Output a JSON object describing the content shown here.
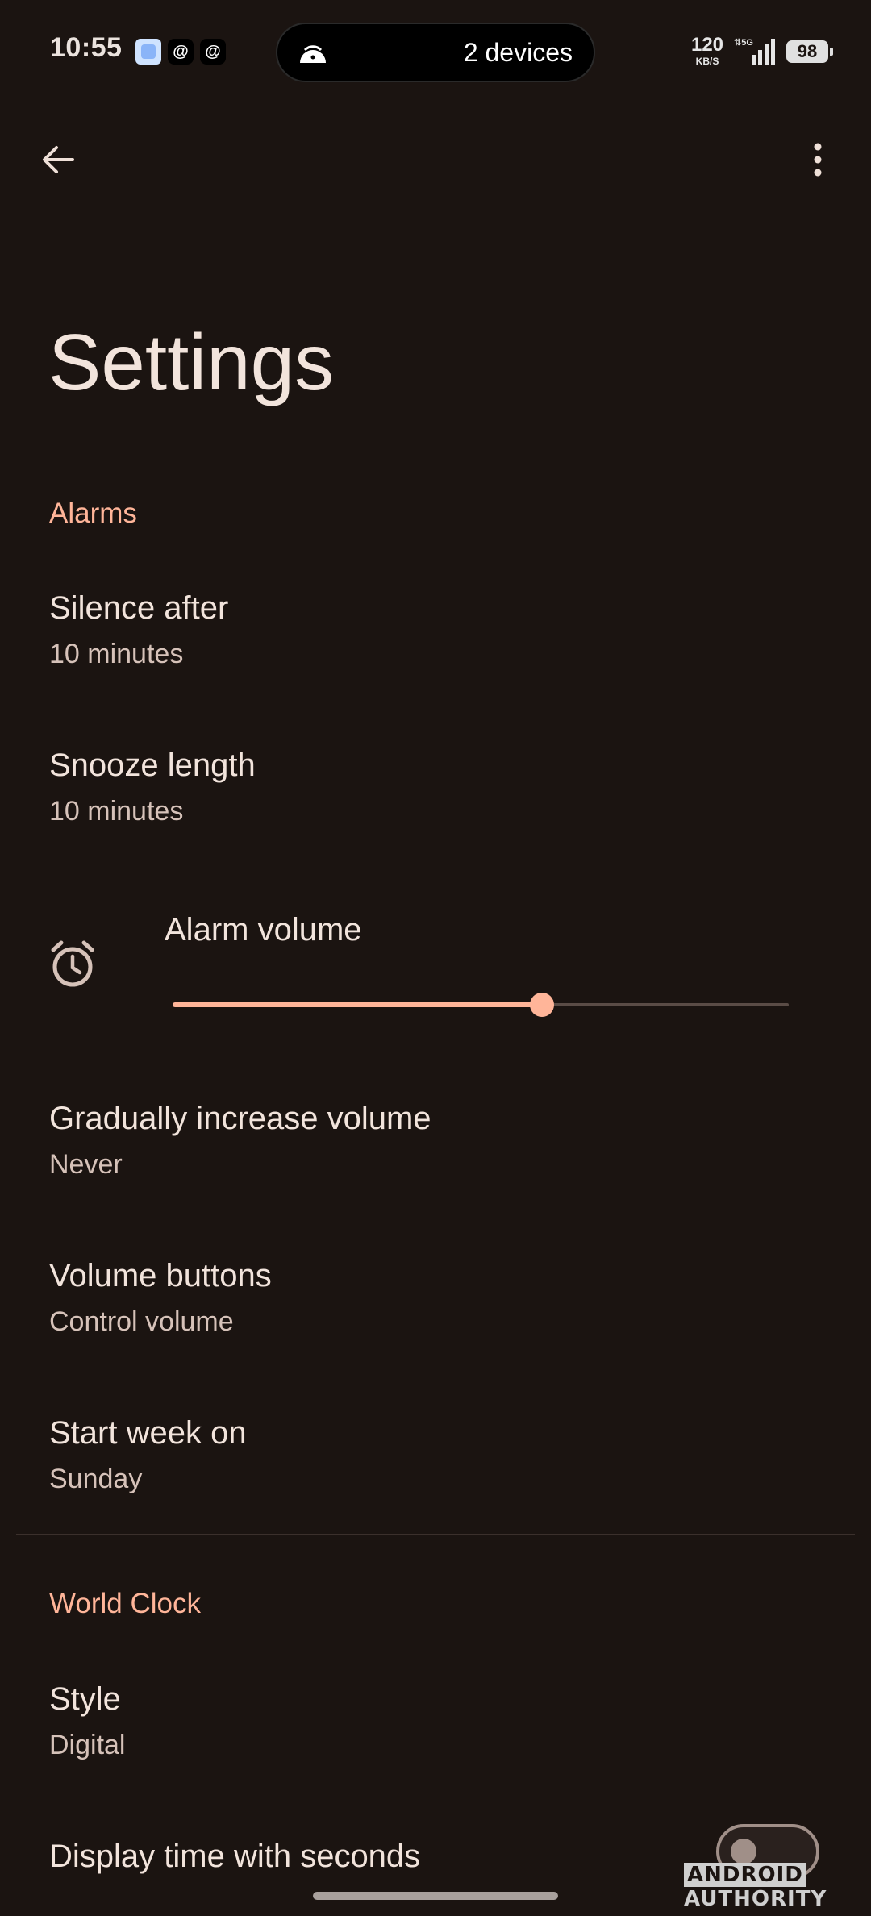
{
  "status_bar": {
    "time": "10:55",
    "notification_icons": [
      "app-icon",
      "threads-icon",
      "threads-icon"
    ],
    "threads_glyph": "@",
    "pill_text": "2 devices",
    "net_speed_value": "120",
    "net_speed_unit": "KB/S",
    "network": "5G",
    "battery": "98"
  },
  "header": {
    "title": "Settings"
  },
  "alarms": {
    "section_label": "Alarms",
    "silence_after": {
      "title": "Silence after",
      "value": "10 minutes"
    },
    "snooze_length": {
      "title": "Snooze length",
      "value": "10 minutes"
    },
    "alarm_volume": {
      "title": "Alarm volume",
      "level": 0.6
    },
    "gradually_increase": {
      "title": "Gradually increase volume",
      "value": "Never"
    },
    "volume_buttons": {
      "title": "Volume buttons",
      "value": "Control volume"
    },
    "start_week": {
      "title": "Start week on",
      "value": "Sunday"
    }
  },
  "world_clock": {
    "section_label": "World Clock",
    "style": {
      "title": "Style",
      "value": "Digital"
    },
    "display_seconds": {
      "title": "Display time with seconds",
      "enabled": false
    }
  },
  "watermark": {
    "part1": "ANDROID",
    "part2": "AUTHORITY"
  },
  "colors": {
    "background": "#1b1411",
    "accent": "#ffb599",
    "text_primary": "#f2e4dc",
    "text_secondary": "#d6c2b9"
  }
}
